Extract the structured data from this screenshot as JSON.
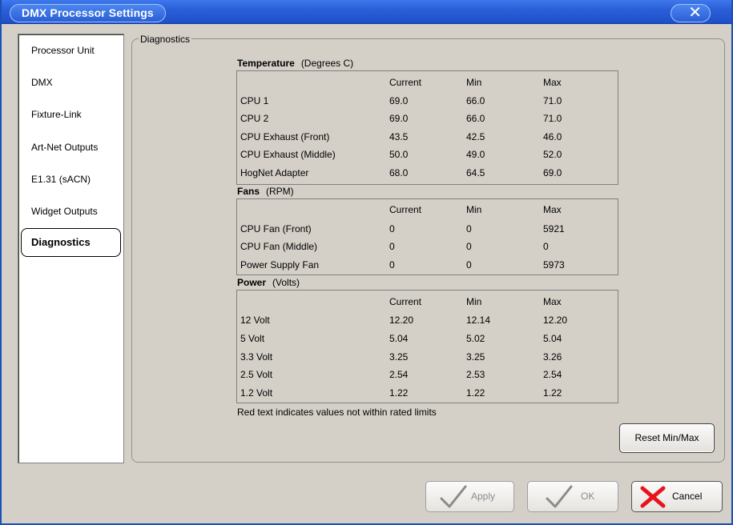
{
  "window": {
    "title": "DMX Processor Settings",
    "close_glyph": "✕"
  },
  "nav": {
    "items": [
      {
        "label": "Processor Unit"
      },
      {
        "label": "DMX"
      },
      {
        "label": "Fixture-Link"
      },
      {
        "label": "Art-Net Outputs"
      },
      {
        "label": "E1.31 (sACN)"
      },
      {
        "label": "Widget Outputs"
      },
      {
        "label": "Diagnostics",
        "selected": true
      }
    ]
  },
  "diagnostics": {
    "group_label": "Diagnostics",
    "columns": [
      "Current",
      "Min",
      "Max"
    ],
    "temperature": {
      "title": "Temperature",
      "unit": "(Degrees C)",
      "rows": [
        {
          "name": "CPU 1",
          "current": "69.0",
          "min": "66.0",
          "max": "71.0"
        },
        {
          "name": "CPU 2",
          "current": "69.0",
          "min": "66.0",
          "max": "71.0"
        },
        {
          "name": "CPU Exhaust (Front)",
          "current": "43.5",
          "min": "42.5",
          "max": "46.0"
        },
        {
          "name": "CPU Exhaust (Middle)",
          "current": "50.0",
          "min": "49.0",
          "max": "52.0"
        },
        {
          "name": "HogNet Adapter",
          "current": "68.0",
          "min": "64.5",
          "max": "69.0"
        }
      ]
    },
    "fans": {
      "title": "Fans",
      "unit": "(RPM)",
      "rows": [
        {
          "name": "CPU Fan (Front)",
          "current": "0",
          "min": "0",
          "max": "5921"
        },
        {
          "name": "CPU Fan (Middle)",
          "current": "0",
          "min": "0",
          "max": "0"
        },
        {
          "name": "Power Supply Fan",
          "current": "0",
          "min": "0",
          "max": "5973"
        }
      ]
    },
    "power": {
      "title": "Power",
      "unit": "(Volts)",
      "rows": [
        {
          "name": "12 Volt",
          "current": "12.20",
          "min": "12.14",
          "max": "12.20"
        },
        {
          "name": "5 Volt",
          "current": "5.04",
          "min": "5.02",
          "max": "5.04"
        },
        {
          "name": "3.3 Volt",
          "current": "3.25",
          "min": "3.25",
          "max": "3.26"
        },
        {
          "name": "2.5 Volt",
          "current": "2.54",
          "min": "2.53",
          "max": "2.54"
        },
        {
          "name": "1.2 Volt",
          "current": "1.22",
          "min": "1.22",
          "max": "1.22"
        }
      ]
    },
    "note": "Red text indicates values not within rated limits",
    "reset_label": "Reset Min/Max"
  },
  "buttons": {
    "apply": {
      "label": "Apply",
      "enabled": false,
      "icon": "check-icon"
    },
    "ok": {
      "label": "OK",
      "enabled": false,
      "icon": "check-icon"
    },
    "cancel": {
      "label": "Cancel",
      "enabled": true,
      "icon": "cross-icon"
    }
  },
  "colors": {
    "title_bar": "#2b5fd8",
    "cancel_x": "#e8141c",
    "check_disabled": "#8a8a8a"
  }
}
